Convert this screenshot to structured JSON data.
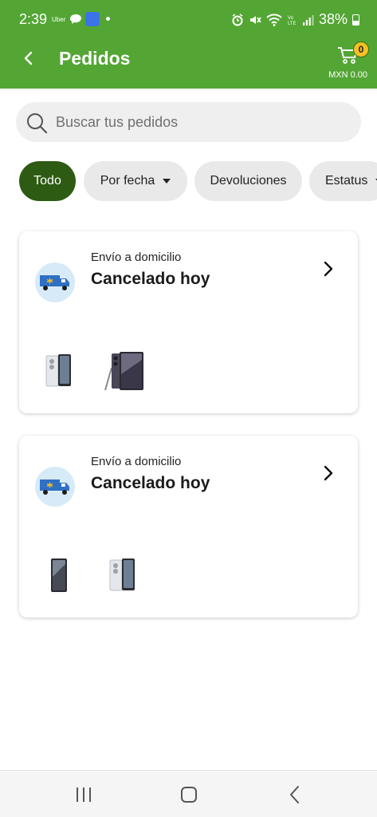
{
  "status_bar": {
    "time": "2:39",
    "app_label": "Uber",
    "battery": "38%"
  },
  "header": {
    "title": "Pedidos",
    "cart_count": "0",
    "cart_total": "MXN 0.00"
  },
  "search": {
    "placeholder": "Buscar tus pedidos",
    "value": ""
  },
  "filters": [
    {
      "label": "Todo",
      "active": true
    },
    {
      "label": "Por fecha",
      "active": false
    },
    {
      "label": "Devoluciones",
      "active": false
    },
    {
      "label": "Estatus",
      "active": false
    }
  ],
  "orders": [
    {
      "delivery_type": "Envío a domicilio",
      "status": "Cancelado hoy"
    },
    {
      "delivery_type": "Envío a domicilio",
      "status": "Cancelado hoy"
    }
  ],
  "colors": {
    "header_green": "#53a633",
    "active_chip": "#2e5b14",
    "cart_badge": "#f6c120",
    "truck_bg": "#d7eaf8"
  }
}
